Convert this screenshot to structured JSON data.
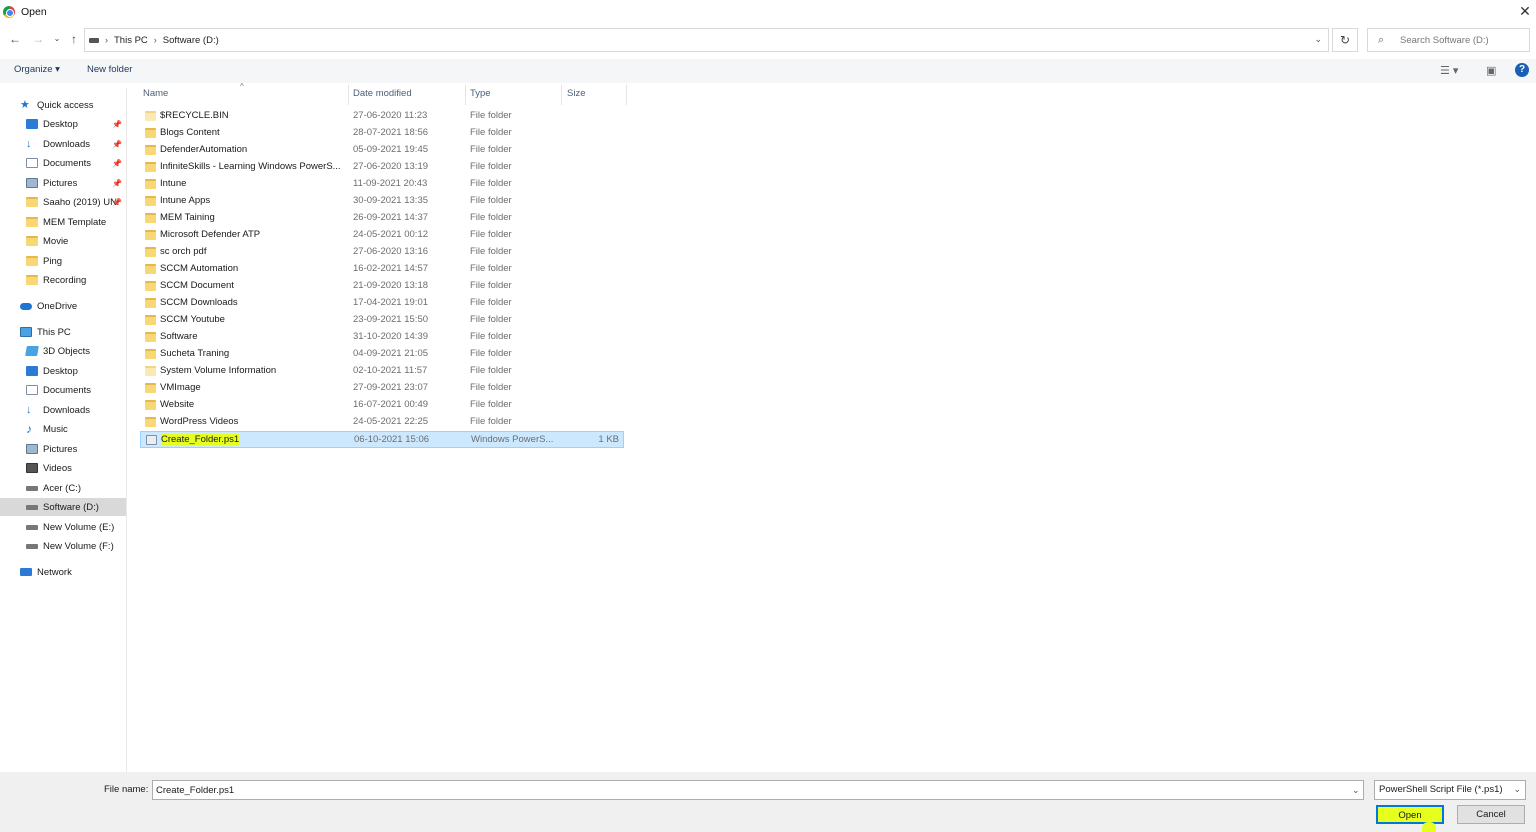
{
  "window": {
    "title": "Open"
  },
  "address": {
    "crumbs": [
      "This PC",
      "Software (D:)"
    ]
  },
  "search": {
    "placeholder": "Search Software (D:)"
  },
  "toolbar": {
    "organize": "Organize ▾",
    "new_folder": "New folder",
    "help": "?"
  },
  "nav": {
    "items": [
      {
        "label": "Quick access",
        "icon": "star-icon",
        "pinned": false
      },
      {
        "label": "Desktop",
        "icon": "desktop-icon",
        "pinned": true
      },
      {
        "label": "Downloads",
        "icon": "download-icon",
        "pinned": true
      },
      {
        "label": "Documents",
        "icon": "document-icon",
        "pinned": true
      },
      {
        "label": "Pictures",
        "icon": "pictures-icon",
        "pinned": true
      },
      {
        "label": "Saaho (2019) UN",
        "icon": "folder-icon",
        "pinned": true
      },
      {
        "label": "MEM Template",
        "icon": "folder-icon",
        "pinned": false
      },
      {
        "label": "Movie",
        "icon": "folder-icon",
        "pinned": false
      },
      {
        "label": "Ping",
        "icon": "folder-icon",
        "pinned": false
      },
      {
        "label": "Recording",
        "icon": "folder-icon",
        "pinned": false
      },
      {
        "label": "OneDrive",
        "icon": "cloud-icon",
        "pinned": false
      },
      {
        "label": "This PC",
        "icon": "computer-icon",
        "pinned": false
      },
      {
        "label": "3D Objects",
        "icon": "cube-icon",
        "pinned": false
      },
      {
        "label": "Desktop",
        "icon": "desktop-icon",
        "pinned": false
      },
      {
        "label": "Documents",
        "icon": "document-icon",
        "pinned": false
      },
      {
        "label": "Downloads",
        "icon": "download-icon",
        "pinned": false
      },
      {
        "label": "Music",
        "icon": "music-icon",
        "pinned": false
      },
      {
        "label": "Pictures",
        "icon": "pictures-icon",
        "pinned": false
      },
      {
        "label": "Videos",
        "icon": "video-icon",
        "pinned": false
      },
      {
        "label": "Acer (C:)",
        "icon": "drive-icon",
        "pinned": false
      },
      {
        "label": "Software (D:)",
        "icon": "drive-icon",
        "pinned": false,
        "selected": true
      },
      {
        "label": "New Volume (E:)",
        "icon": "drive-icon",
        "pinned": false
      },
      {
        "label": "New Volume (F:)",
        "icon": "drive-icon",
        "pinned": false
      },
      {
        "label": "Network",
        "icon": "network-icon",
        "pinned": false
      }
    ]
  },
  "columns": {
    "name": "Name",
    "date": "Date modified",
    "type": "Type",
    "size": "Size"
  },
  "files": [
    {
      "name": "$RECYCLE.BIN",
      "date": "27-06-2020 11:23",
      "type": "File folder",
      "size": ""
    },
    {
      "name": "Blogs Content",
      "date": "28-07-2021 18:56",
      "type": "File folder",
      "size": ""
    },
    {
      "name": "DefenderAutomation",
      "date": "05-09-2021 19:45",
      "type": "File folder",
      "size": ""
    },
    {
      "name": "InfiniteSkills - Learning Windows PowerS...",
      "date": "27-06-2020 13:19",
      "type": "File folder",
      "size": ""
    },
    {
      "name": "Intune",
      "date": "11-09-2021 20:43",
      "type": "File folder",
      "size": ""
    },
    {
      "name": "Intune Apps",
      "date": "30-09-2021 13:35",
      "type": "File folder",
      "size": ""
    },
    {
      "name": "MEM Taining",
      "date": "26-09-2021 14:37",
      "type": "File folder",
      "size": ""
    },
    {
      "name": "Microsoft Defender ATP",
      "date": "24-05-2021 00:12",
      "type": "File folder",
      "size": ""
    },
    {
      "name": "sc orch pdf",
      "date": "27-06-2020 13:16",
      "type": "File folder",
      "size": ""
    },
    {
      "name": "SCCM Automation",
      "date": "16-02-2021 14:57",
      "type": "File folder",
      "size": ""
    },
    {
      "name": "SCCM Document",
      "date": "21-09-2020 13:18",
      "type": "File folder",
      "size": ""
    },
    {
      "name": "SCCM Downloads",
      "date": "17-04-2021 19:01",
      "type": "File folder",
      "size": ""
    },
    {
      "name": "SCCM Youtube",
      "date": "23-09-2021 15:50",
      "type": "File folder",
      "size": ""
    },
    {
      "name": "Software",
      "date": "31-10-2020 14:39",
      "type": "File folder",
      "size": ""
    },
    {
      "name": "Sucheta Traning",
      "date": "04-09-2021 21:05",
      "type": "File folder",
      "size": ""
    },
    {
      "name": "System Volume Information",
      "date": "02-10-2021 11:57",
      "type": "File folder",
      "size": ""
    },
    {
      "name": "VMImage",
      "date": "27-09-2021 23:07",
      "type": "File folder",
      "size": ""
    },
    {
      "name": "Website",
      "date": "16-07-2021 00:49",
      "type": "File folder",
      "size": ""
    },
    {
      "name": "WordPress Videos",
      "date": "24-05-2021 22:25",
      "type": "File folder",
      "size": ""
    },
    {
      "name": "Create_Folder.ps1",
      "date": "06-10-2021 15:06",
      "type": "Windows PowerS...",
      "size": "1 KB",
      "selected": true
    }
  ],
  "footer": {
    "file_name_label": "File name:",
    "file_name_value": "Create_Folder.ps1",
    "filter": "PowerShell Script File (*.ps1)",
    "open": "Open",
    "cancel": "Cancel"
  },
  "colors": {
    "selection": "#cce8ff",
    "highlight": "#e6ff1e",
    "accent": "#0078d7"
  }
}
